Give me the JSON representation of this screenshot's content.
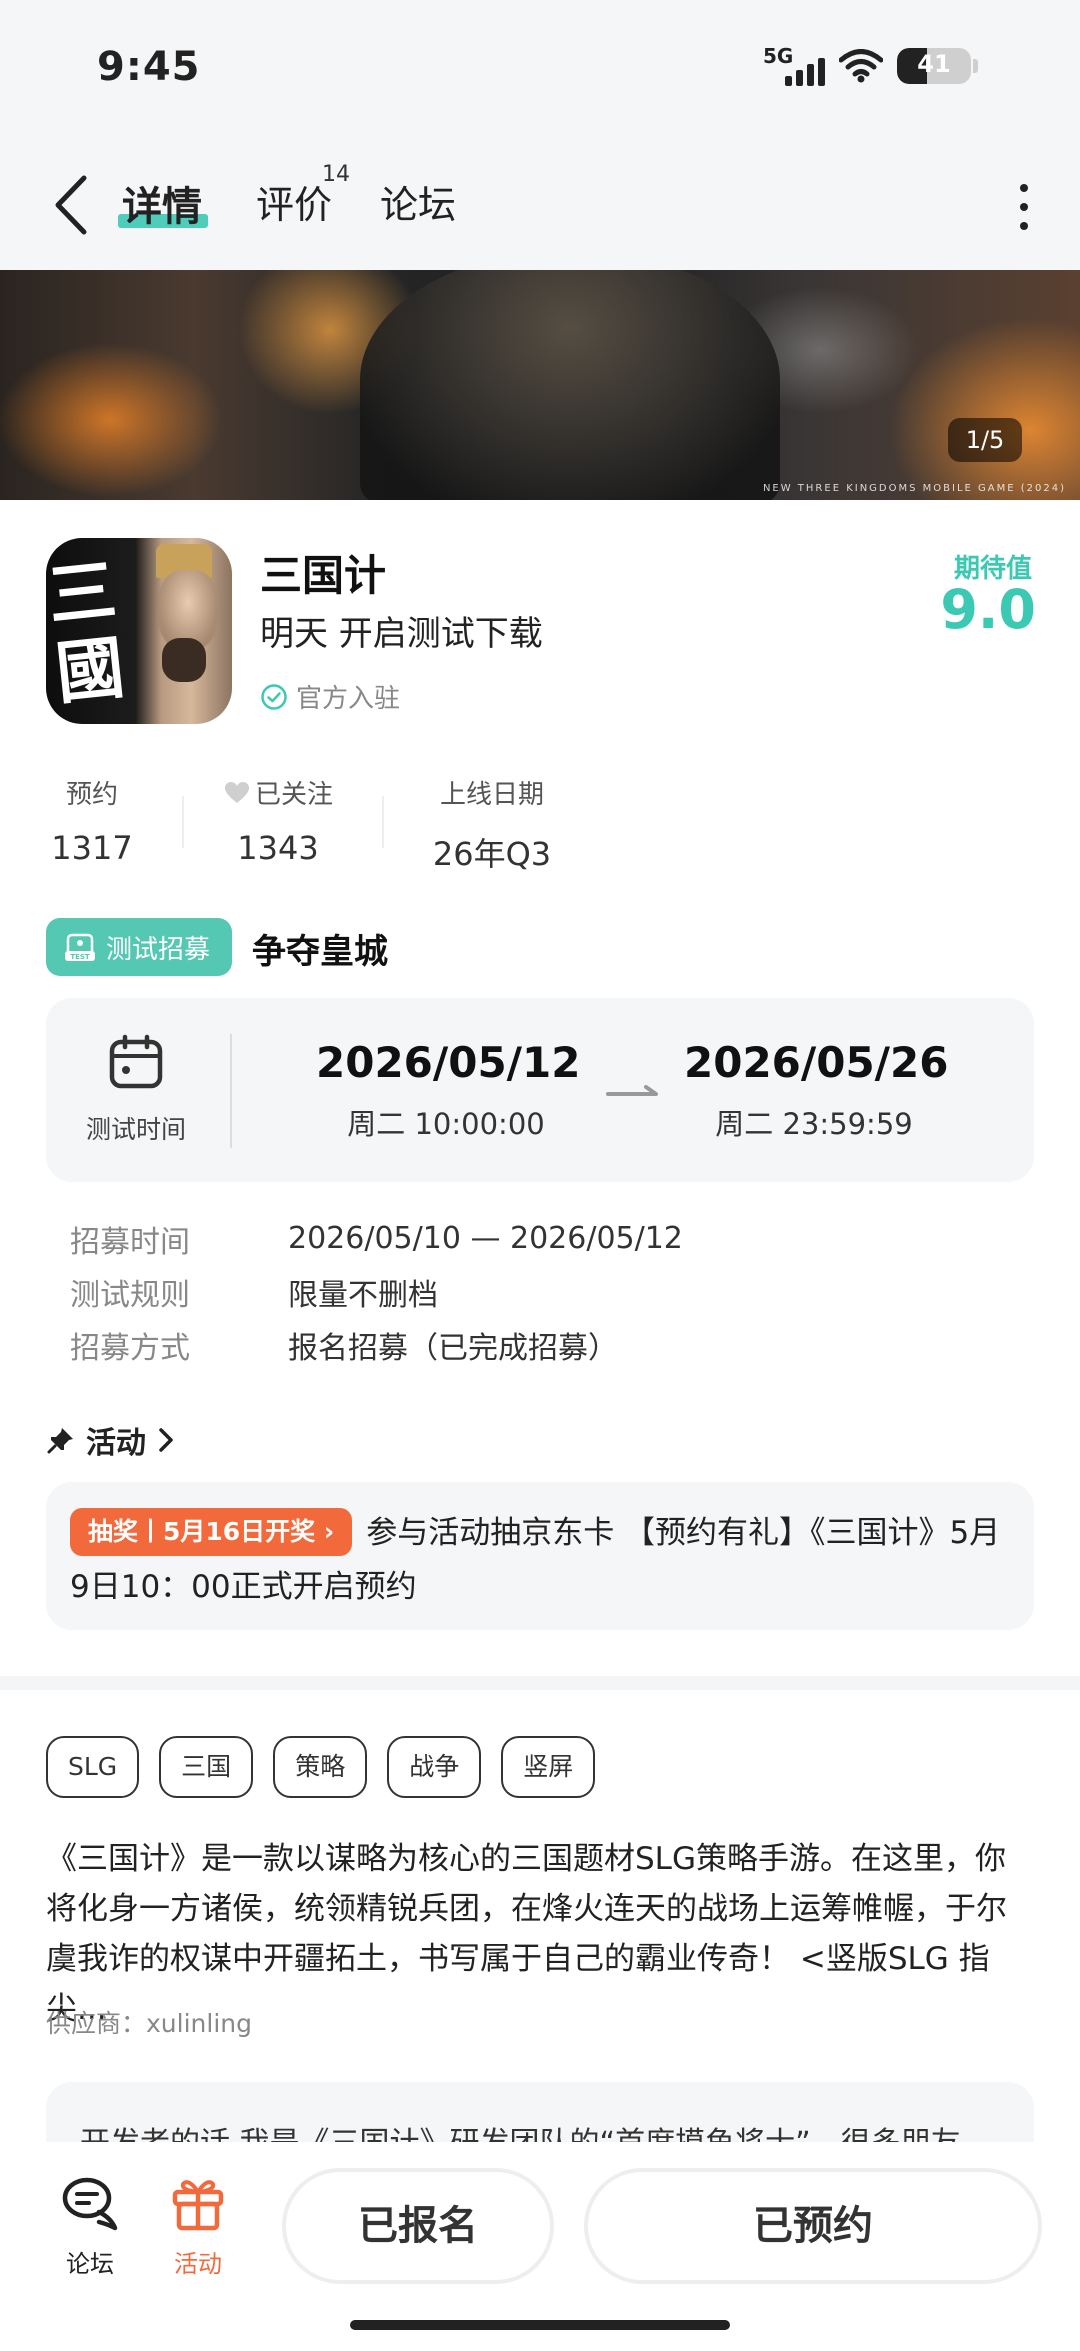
{
  "status_bar": {
    "time": "9:45",
    "network": "5G",
    "battery": "41",
    "battery_level": 0.41
  },
  "header": {
    "tabs": [
      {
        "label": "详情",
        "active": true
      },
      {
        "label": "评价",
        "badge": "14"
      },
      {
        "label": "论坛"
      }
    ],
    "icons": {
      "back": "back-chevron-icon",
      "more": "more-vertical-icon"
    }
  },
  "banner": {
    "counter": "1/5",
    "caption": "NEW THREE KINGDOMS MOBILE GAME (2024)"
  },
  "app": {
    "name": "三国计",
    "subtitle": "明天 开启测试下载",
    "official": "官方入驻",
    "icon_text": "三國",
    "expect_label": "期待值",
    "expect_value": "9.0"
  },
  "stats": [
    {
      "label": "预约",
      "value": "1317"
    },
    {
      "label": "已关注",
      "value": "1343",
      "icon": "heart-icon"
    },
    {
      "label": "上线日期",
      "value": "26年Q3"
    }
  ],
  "test": {
    "badge": "测试招募",
    "title": "争夺皇城",
    "time_label": "测试时间",
    "start": {
      "date": "2026/05/12",
      "time": "周二  10:00:00"
    },
    "end": {
      "date": "2026/05/26",
      "time": "周二  23:59:59"
    },
    "rows": [
      {
        "key": "招募时间",
        "value": "2026/05/10 — 2026/05/12"
      },
      {
        "key": "测试规则",
        "value": "限量不删档"
      },
      {
        "key": "招募方式",
        "value": "报名招募（已完成招募）"
      }
    ]
  },
  "activity": {
    "header": "活动",
    "badge": "抽奖丨5月16日开奖 ›",
    "text": "参与活动抽京东卡 【预约有礼】《三国计》5月9日10：00正式开启预约"
  },
  "tags": [
    "SLG",
    "三国",
    "策略",
    "战争",
    "竖屏"
  ],
  "description": "《三国计》是一款以谋略为核心的三国题材SLG策略手游。在这里，你将化身一方诸侯，统领精锐兵团，在烽火连天的战场上运筹帷幄，于尔虞我诈的权谋中开疆拓土，书写属于自己的霸业传奇！ <竖版SLG 指尖...",
  "supplier": "供应商：xulinling",
  "developer_note": "开发者的话  我是《三国计》研发团队的“首席摸鱼将士”，很多朋友",
  "bottom": {
    "nav": [
      {
        "label": "论坛",
        "icon": "forum-chat-icon"
      },
      {
        "label": "活动",
        "icon": "gift-icon"
      }
    ],
    "btn_signed": "已报名",
    "btn_reserved": "已预约"
  },
  "colors": {
    "accent": "#3cc9b4",
    "orange": "#f26a3c",
    "card_bg": "#f5f6f7"
  }
}
